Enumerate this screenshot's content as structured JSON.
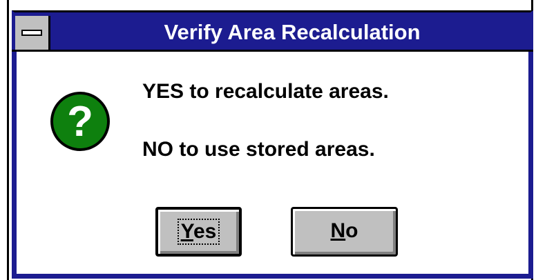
{
  "window": {
    "title": "Verify Area Recalculation",
    "system_menu_icon": "system-menu-icon"
  },
  "icon": {
    "name": "question-icon",
    "glyph": "?",
    "color": "#0e800e"
  },
  "message": {
    "line1": "YES to recalculate areas.",
    "line2": "NO to use stored areas."
  },
  "buttons": {
    "yes_label": "Yes",
    "no_label": "No"
  },
  "colors": {
    "titlebar": "#1c1c90",
    "button_face": "#c0c0c0"
  }
}
